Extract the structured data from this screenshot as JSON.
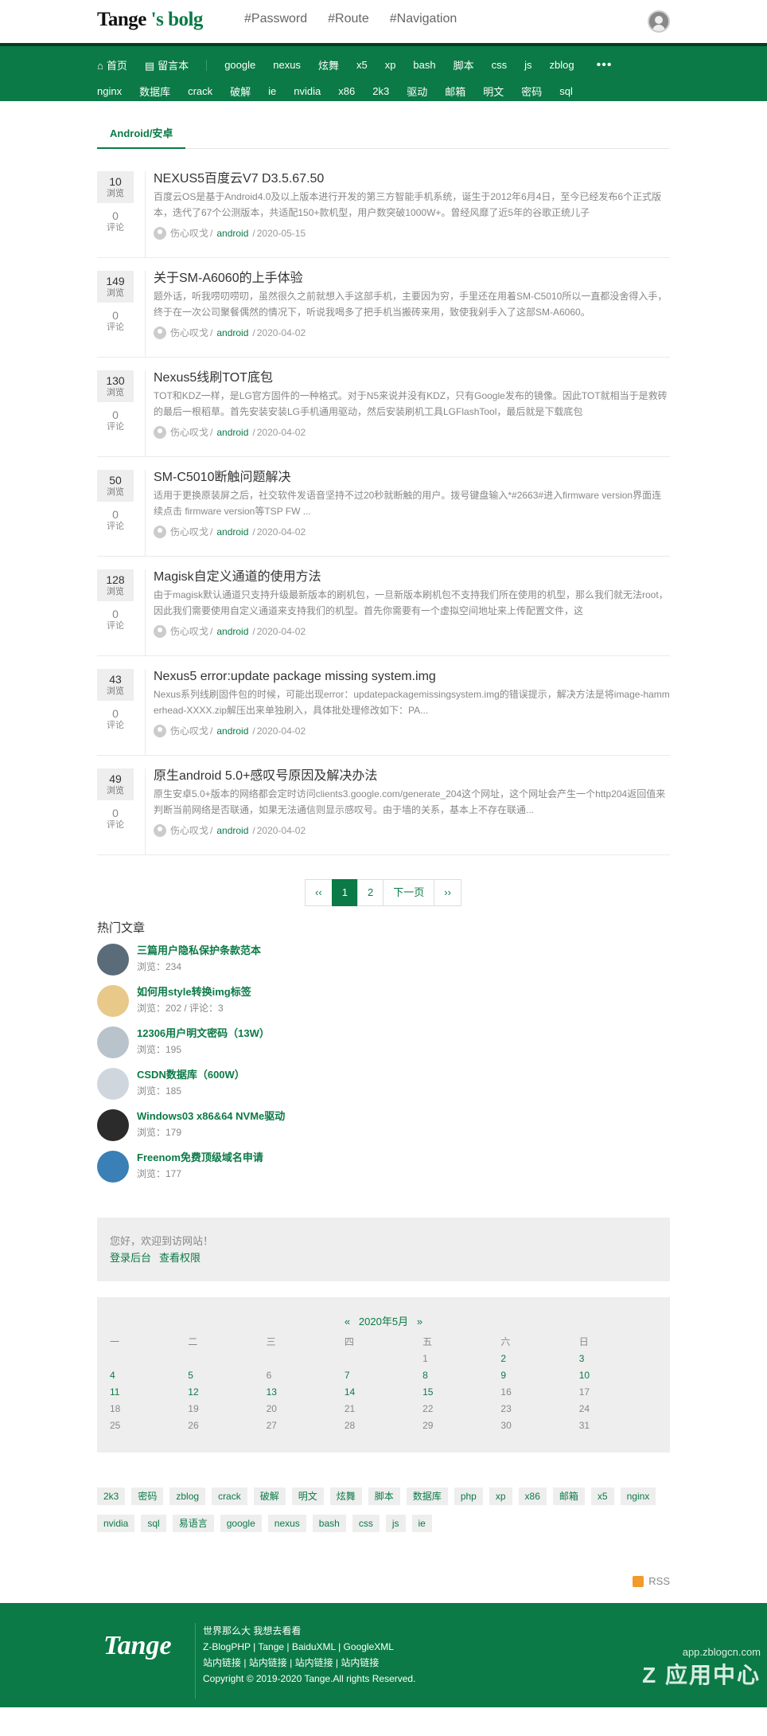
{
  "header": {
    "logo_main": "Tange",
    "logo_accent": " 's bolg",
    "nav": [
      "#Password",
      "#Route",
      "#Navigation"
    ]
  },
  "menu": {
    "row1_main": [
      {
        "icon": "home-icon",
        "glyph": "⌂",
        "label": "首页"
      },
      {
        "icon": "guestbook-icon",
        "glyph": "▤",
        "label": "留言本"
      }
    ],
    "row1_tags": [
      "google",
      "nexus",
      "炫舞",
      "x5",
      "xp",
      "bash",
      "脚本",
      "css",
      "js",
      "zblog"
    ],
    "more": "•••",
    "row2_tags": [
      "nginx",
      "数据库",
      "crack",
      "破解",
      "ie",
      "nvidia",
      "x86",
      "2k3",
      "驱动",
      "邮箱",
      "明文",
      "密码",
      "sql"
    ]
  },
  "tab": {
    "label": "Android/安卓"
  },
  "labels": {
    "views": "浏览",
    "comments": "评论"
  },
  "posts": [
    {
      "views": "10",
      "comments": "0",
      "title": "NEXUS5百度云V7 D3.5.67.50",
      "desc": "百度云OS是基于Android4.0及以上版本进行开发的第三方智能手机系统，诞生于2012年6月4日，至今已经发布6个正式版本，迭代了67个公测版本，共适配150+款机型，用户数突破1000W+。曾经风靡了近5年的谷歌正统儿子",
      "author": "伤心叹戈",
      "category": "android",
      "date": "2020-05-15"
    },
    {
      "views": "149",
      "comments": "0",
      "title": "关于SM-A6060的上手体验",
      "desc": "题外话，听我唠叨唠叨，虽然很久之前就想入手这部手机，主要因为穷，手里还在用着SM-C5010所以一直都没舍得入手，终于在一次公司聚餐偶然的情况下，听说我喝多了把手机当搬砖来用，致使我剁手入了这部SM-A6060。",
      "author": "伤心叹戈",
      "category": "android",
      "date": "2020-04-02"
    },
    {
      "views": "130",
      "comments": "0",
      "title": "Nexus5线刷TOT底包",
      "desc": "TOT和KDZ一样，是LG官方固件的一种格式。对于N5来说并没有KDZ，只有Google发布的镜像。因此TOT就相当于是救砖的最后一根稻草。首先安装安装LG手机通用驱动，然后安装刷机工具LGFlashTool，最后就是下载底包",
      "author": "伤心叹戈",
      "category": "android",
      "date": "2020-04-02"
    },
    {
      "views": "50",
      "comments": "0",
      "title": "SM-C5010断触问题解决",
      "desc": "适用于更换原装屏之后，社交软件发语音坚持不过20秒就断触的用户。拨号键盘输入*#2663#进入firmware version界面连续点击 firmware version等TSP FW ...",
      "author": "伤心叹戈",
      "category": "android",
      "date": "2020-04-02"
    },
    {
      "views": "128",
      "comments": "0",
      "title": "Magisk自定义通道的使用方法",
      "desc": "由于magisk默认通道只支持升级最新版本的刷机包，一旦新版本刷机包不支持我们所在使用的机型，那么我们就无法root，因此我们需要使用自定义通道来支持我们的机型。首先你需要有一个虚拟空间地址来上传配置文件，这",
      "author": "伤心叹戈",
      "category": "android",
      "date": "2020-04-02"
    },
    {
      "views": "43",
      "comments": "0",
      "title": "Nexus5 error:update package missing system.img",
      "desc": "Nexus系列线刷固件包的时候，可能出现error：updatepackagemissingsystem.img的错误提示，解决方法是将image-hammerhead-XXXX.zip解压出来单独刷入，具体批处理修改如下：PA...",
      "author": "伤心叹戈",
      "category": "android",
      "date": "2020-04-02"
    },
    {
      "views": "49",
      "comments": "0",
      "title": "原生android 5.0+感叹号原因及解决办法",
      "desc": "原生安卓5.0+版本的网络都会定时访问clients3.google.com/generate_204这个网址，这个网址会产生一个http204返回值来判断当前网络是否联通，如果无法通信则显示感叹号。由于墙的关系，基本上不存在联通...",
      "author": "伤心叹戈",
      "category": "android",
      "date": "2020-04-02"
    }
  ],
  "pagination": {
    "first": "‹‹",
    "pages": [
      "1",
      "2"
    ],
    "next": "下一页",
    "last": "››"
  },
  "hot": {
    "title": "热门文章",
    "items": [
      {
        "title": "三篇用户隐私保护条款范本",
        "stats": "浏览：234",
        "thumb_color": "#5a6b7a"
      },
      {
        "title": "如何用style转换img标签",
        "stats": "浏览：202 / 评论：3",
        "thumb_color": "#e8c98a"
      },
      {
        "title": "12306用户明文密码（13W）",
        "stats": "浏览：195",
        "thumb_color": "#b9c3cc"
      },
      {
        "title": "CSDN数据库（600W）",
        "stats": "浏览：185",
        "thumb_color": "#cfd6dd"
      },
      {
        "title": "Windows03 x86&64 NVMe驱动",
        "stats": "浏览：179",
        "thumb_color": "#2b2b2b"
      },
      {
        "title": "Freenom免费顶级域名申请",
        "stats": "浏览：177",
        "thumb_color": "#3a7fb5"
      }
    ]
  },
  "welcome": {
    "text": "您好，欢迎到访网站！",
    "login": "登录后台",
    "perms": "查看权限"
  },
  "calendar": {
    "prev": "«",
    "month": "2020年5月",
    "next": "»",
    "weekdays": [
      "一",
      "二",
      "三",
      "四",
      "五",
      "六",
      "日"
    ],
    "weeks": [
      [
        "",
        "",
        "",
        "",
        "1",
        "2",
        "3"
      ],
      [
        "4",
        "5",
        "6",
        "7",
        "8",
        "9",
        "10"
      ],
      [
        "11",
        "12",
        "13",
        "14",
        "15",
        "16",
        "17"
      ],
      [
        "18",
        "19",
        "20",
        "21",
        "22",
        "23",
        "24"
      ],
      [
        "25",
        "26",
        "27",
        "28",
        "29",
        "30",
        "31"
      ]
    ],
    "linked_days": [
      "2",
      "3",
      "4",
      "5",
      "7",
      "8",
      "9",
      "10",
      "11",
      "12",
      "13",
      "14",
      "15"
    ]
  },
  "tags": [
    "2k3",
    "密码",
    "zblog",
    "crack",
    "破解",
    "明文",
    "炫舞",
    "脚本",
    "数据库",
    "php",
    "xp",
    "x86",
    "邮箱",
    "x5",
    "nginx",
    "nvidia",
    "sql",
    "易语言",
    "google",
    "nexus",
    "bash",
    "css",
    "js",
    "ie"
  ],
  "rss": {
    "label": "RSS"
  },
  "footer": {
    "logo": "Tange",
    "lines": [
      "世界那么大 我想去看看",
      "Z-BlogPHP | Tange | BaiduXML | GoogleXML",
      "站内链接 | 站内链接 | 站内链接 | 站内链接",
      "Copyright © 2019-2020 Tange.All rights Reserved."
    ]
  },
  "watermark": {
    "url": "app.zblogcn.com",
    "brand": "Z 应用中心"
  },
  "colors": {
    "brand_green": "#0b7a46",
    "dark_green": "#043d23",
    "panel_gray": "#eeeeee"
  }
}
